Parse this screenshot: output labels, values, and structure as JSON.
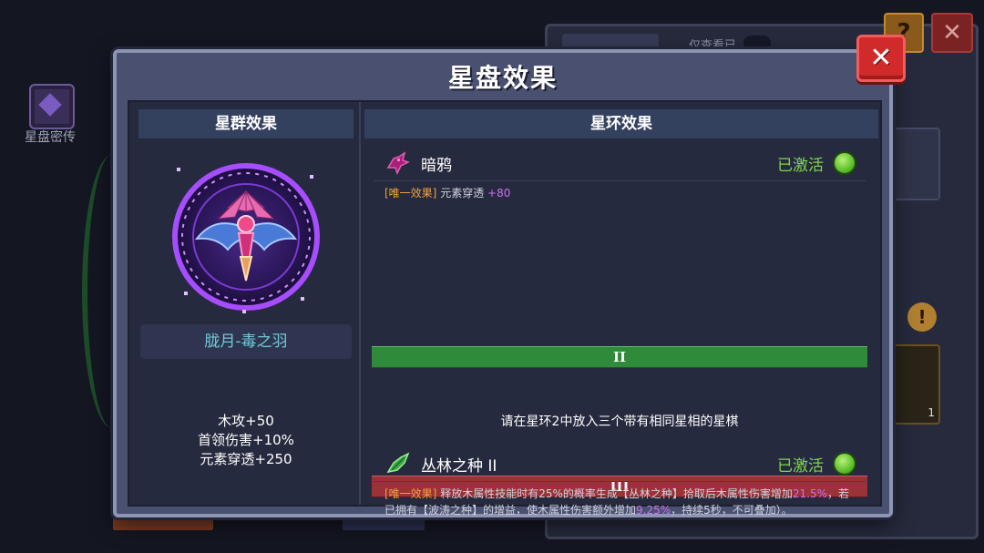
{
  "background": {
    "left_icon_label": "星盘密传",
    "filter_toggle_label": "仅查看已",
    "help_glyph": "?",
    "close_glyph": "✕",
    "warning_glyph": "!",
    "slot_count": "1"
  },
  "dialog": {
    "title": "星盘效果",
    "close_glyph": "✕",
    "left": {
      "header": "星群效果",
      "constellation_name": "胧月-毒之羽",
      "stats": [
        "木攻+50",
        "首领伤害+10%",
        "元素穿透+250"
      ]
    },
    "right": {
      "header": "星环效果",
      "ring1": {
        "icon": "dark-crow-icon",
        "name": "暗鸦",
        "status": "已激活",
        "desc_tag": "[唯一效果]",
        "desc_text": " 元素穿透 ",
        "desc_value": "+80"
      },
      "tier2": {
        "label": "II",
        "hint": "请在星环2中放入三个带有相同星相的星棋"
      },
      "tier3": {
        "label": "III"
      },
      "ring3": {
        "icon": "jungle-seed-icon",
        "name": "丛林之种 II",
        "status": "已激活",
        "desc_tag": "[唯一效果]",
        "desc_part1": " 释放木属性技能时有25%的概率生成【丛林之种】拾取后木属性伤害增加",
        "desc_value1": "21.5%",
        "desc_part2": "，若已拥有【波涛之种】的增益，使木属性伤害额外增加",
        "desc_value2": "9.25%",
        "desc_part3": "，持续5秒，不可叠加）。"
      }
    }
  },
  "colors": {
    "dialog_bg": "#4a5070",
    "inner_bg": "#262a3e",
    "header_bg": "#33405e",
    "active_green": "#7ed84a",
    "tag_orange": "#f0a040",
    "value_purple": "#c873f0",
    "name_cyan": "#6fc9d6",
    "tier_green": "#2f8a3a",
    "tier_red": "#9a3238",
    "close_red": "#d02a2a"
  }
}
